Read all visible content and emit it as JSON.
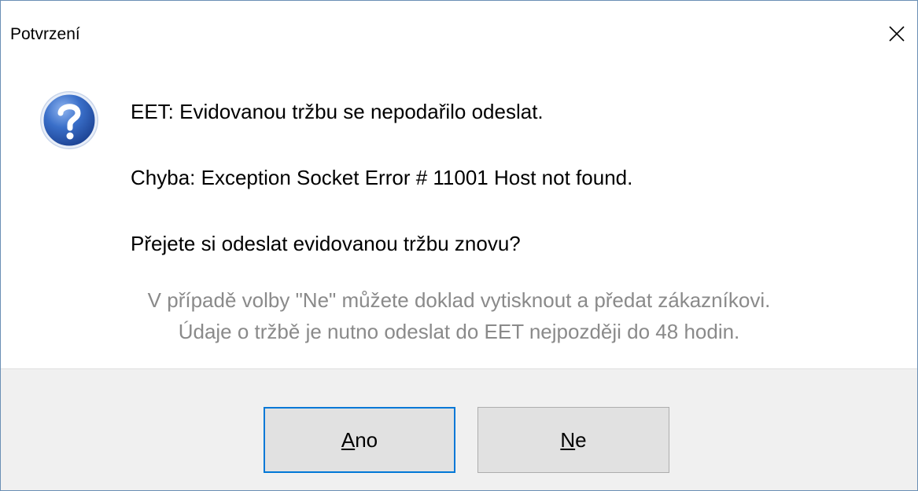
{
  "window": {
    "title": "Potvrzení",
    "close_icon": "close-icon"
  },
  "message": {
    "icon": "question-icon",
    "line1": "EET: Evidovanou tržbu se nepodařilo odeslat.",
    "line2": "Chyba: Exception Socket Error # 11001 Host not found.",
    "line3": "Přejete si odeslat evidovanou tržbu znovu?",
    "note1": "V případě volby \"Ne\" můžete doklad vytisknout a předat zákazníkovi.",
    "note2": "Údaje o tržbě je nutno odeslat do EET nejpozději do 48 hodin."
  },
  "buttons": {
    "yes": {
      "mnemonic": "A",
      "rest": "no"
    },
    "no": {
      "mnemonic": "N",
      "rest": "e"
    }
  },
  "colors": {
    "accent": "#0078d7",
    "note_text": "#8a8a8a",
    "footer_bg": "#f0f0f0"
  }
}
